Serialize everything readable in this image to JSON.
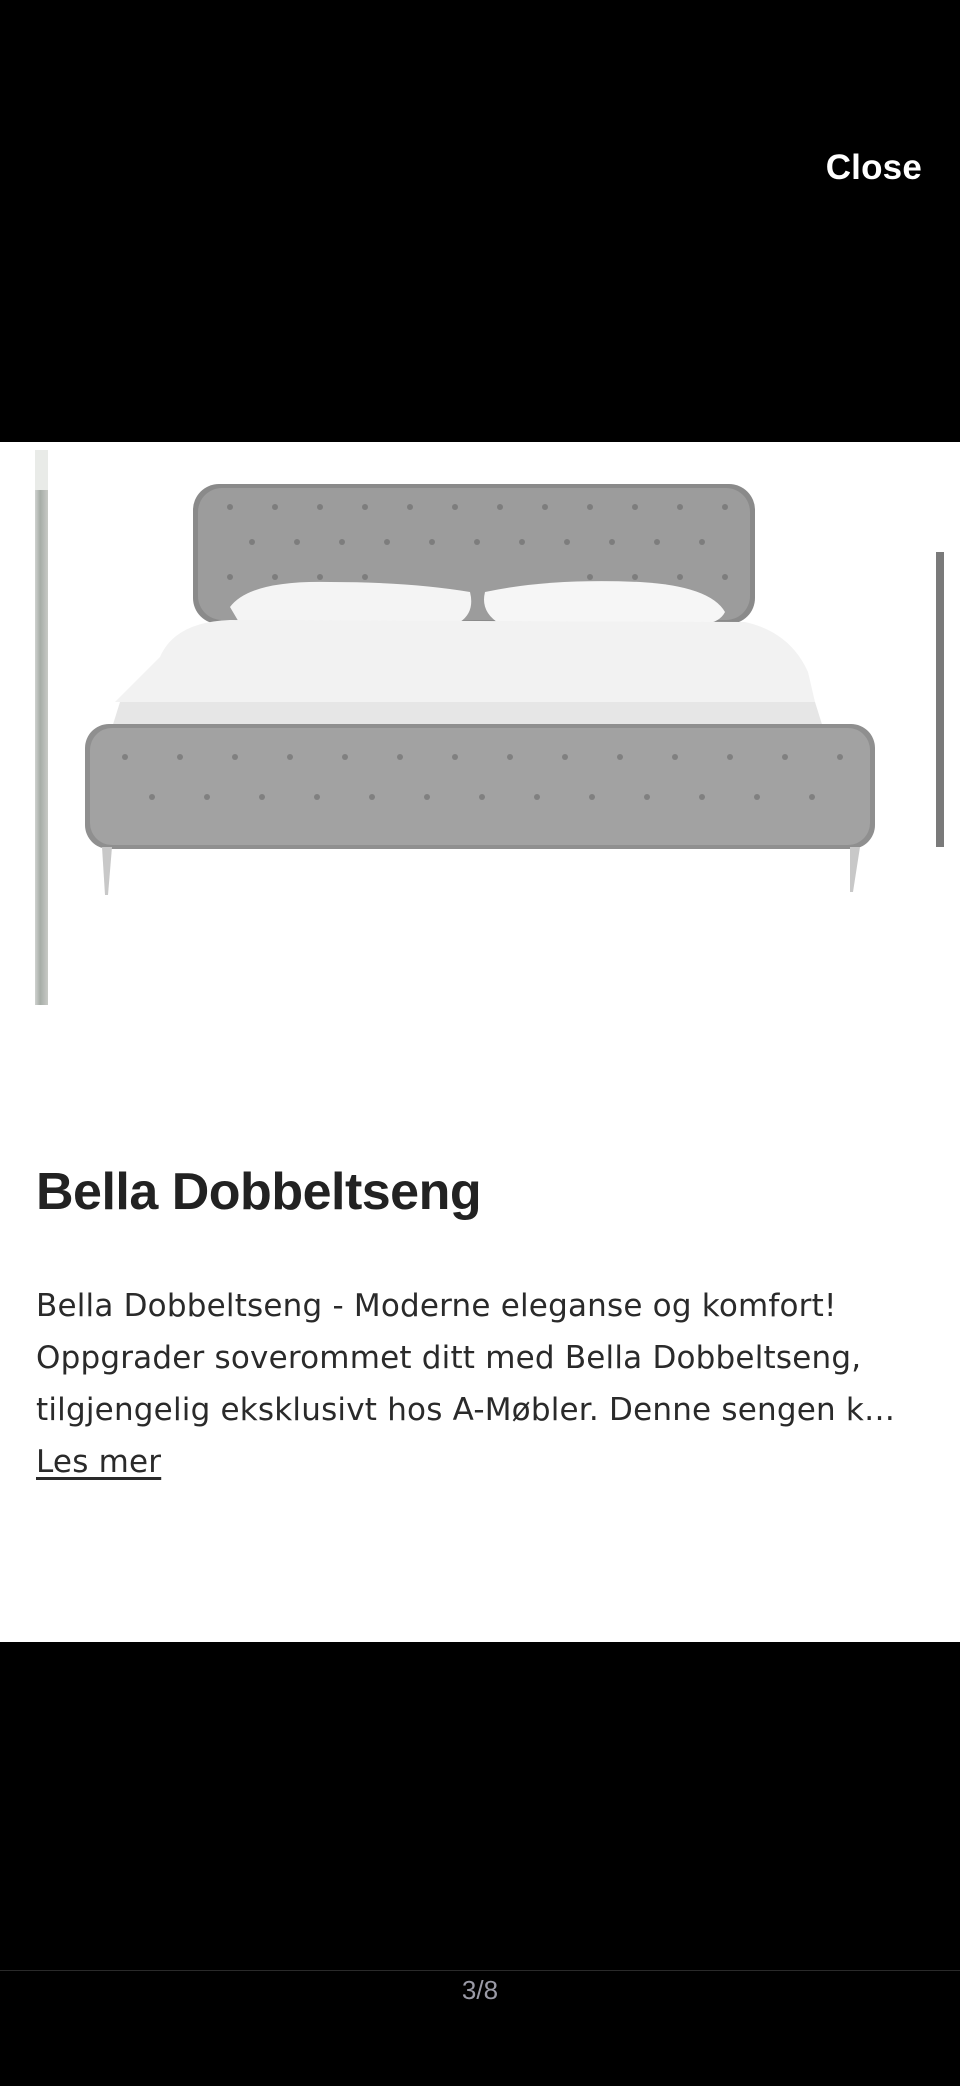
{
  "header": {
    "close_label": "Close"
  },
  "product": {
    "title": "Bella Dobbeltseng",
    "description_lines": [
      "Bella Dobbeltseng - Moderne eleganse og komfort!",
      "Oppgrader soverommet ditt med Bella Dobbeltseng,",
      "tilgjengelig eksklusivt hos A-Møbler. Denne sengen k…"
    ],
    "read_more_label": "Les mer"
  },
  "pager": {
    "text": "3/8"
  }
}
